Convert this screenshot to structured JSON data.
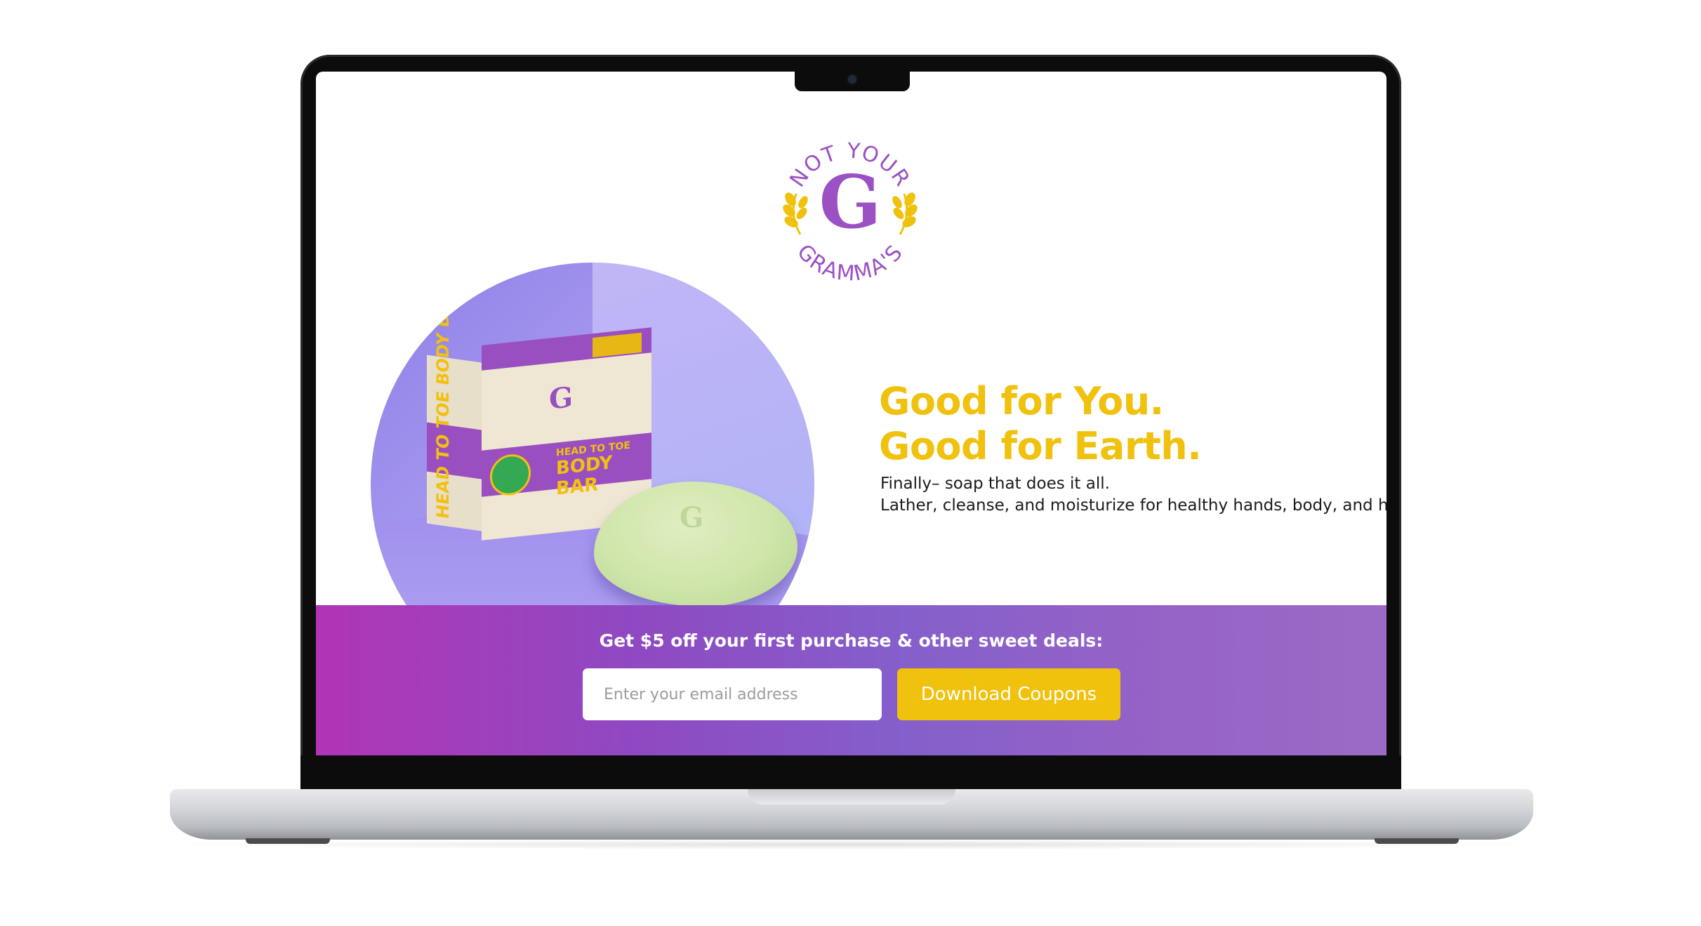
{
  "logo": {
    "arc_top": "NOT YOUR",
    "letter": "G",
    "arc_bottom": "GRAMMA'S"
  },
  "product": {
    "box_side_label": "HEAD TO TOE BODY BAR",
    "box_letter": "G",
    "box_title_small": "HEAD TO TOE",
    "box_title_big": "BODY BAR",
    "soap_letter": "G"
  },
  "hero": {
    "headline_line1": "Good for You.",
    "headline_line2": "Good for Earth.",
    "desc_line1": "Finally– soap that does it all.",
    "desc_line2": "Lather, cleanse, and moisturize for healthy hands, body, and hair."
  },
  "signup": {
    "title": "Get $5 off your first purchase & other sweet deals:",
    "email_placeholder": "Enter your email address",
    "email_value": "",
    "button_label": "Download Coupons"
  },
  "colors": {
    "brand_purple": "#9b50c4",
    "accent_yellow": "#f0c10d",
    "banner_start": "#b035b5",
    "banner_end": "#9b6bc6"
  }
}
